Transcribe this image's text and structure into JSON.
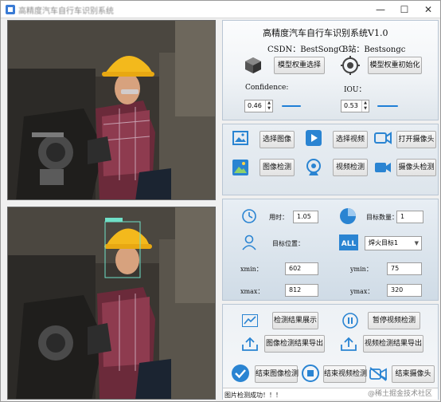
{
  "window": {
    "title": "高精度汽车自行车识别系统",
    "controls": {
      "minimize": "—",
      "maximize": "☐",
      "close": "✕"
    }
  },
  "header": {
    "title": "高精度汽车自行车识别系统V1.0",
    "csdn": "CSDN：BestSongC",
    "bilibili": "B站：Bestsongc"
  },
  "model": {
    "select_weights": "模型权重选择",
    "init_weights": "模型权重初始化",
    "confidence_label": "Confidence:",
    "confidence_value": "0.46",
    "iou_label": "IOU：",
    "iou_value": "0.53"
  },
  "source": {
    "choose_image": "选择图像",
    "choose_video": "选择视频",
    "open_camera": "打开摄像头",
    "image_detect": "图像检测",
    "video_detect": "视频检测",
    "camera_detect": "摄像头检测"
  },
  "results": {
    "time_label": "用时：",
    "time_value": "1.05",
    "target_count_label": "目标数量：",
    "target_count_value": "1",
    "target_pos_label": "目标位置：",
    "target_select_value": "焊火目标1",
    "xmin_label": "xmin：",
    "xmin_value": "602",
    "ymin_label": "ymin：",
    "ymin_value": "75",
    "xmax_label": "xmax：",
    "xmax_value": "812",
    "ymax_label": "ymax：",
    "ymax_value": "320"
  },
  "actions": {
    "show_result": "检测结果展示",
    "pause_video": "暂停视频检测",
    "export_image": "图像检测结果导出",
    "export_video": "视频检测结果导出",
    "end_image": "结束图像检测",
    "end_video": "结束视频检测",
    "end_camera": "结束摄像头"
  },
  "status": {
    "message": "图片检测成功！！！"
  },
  "watermark": "@稀土掘金技术社区",
  "colors": {
    "accent": "#1f7fd6",
    "icon_blue": "#2a84d2"
  }
}
